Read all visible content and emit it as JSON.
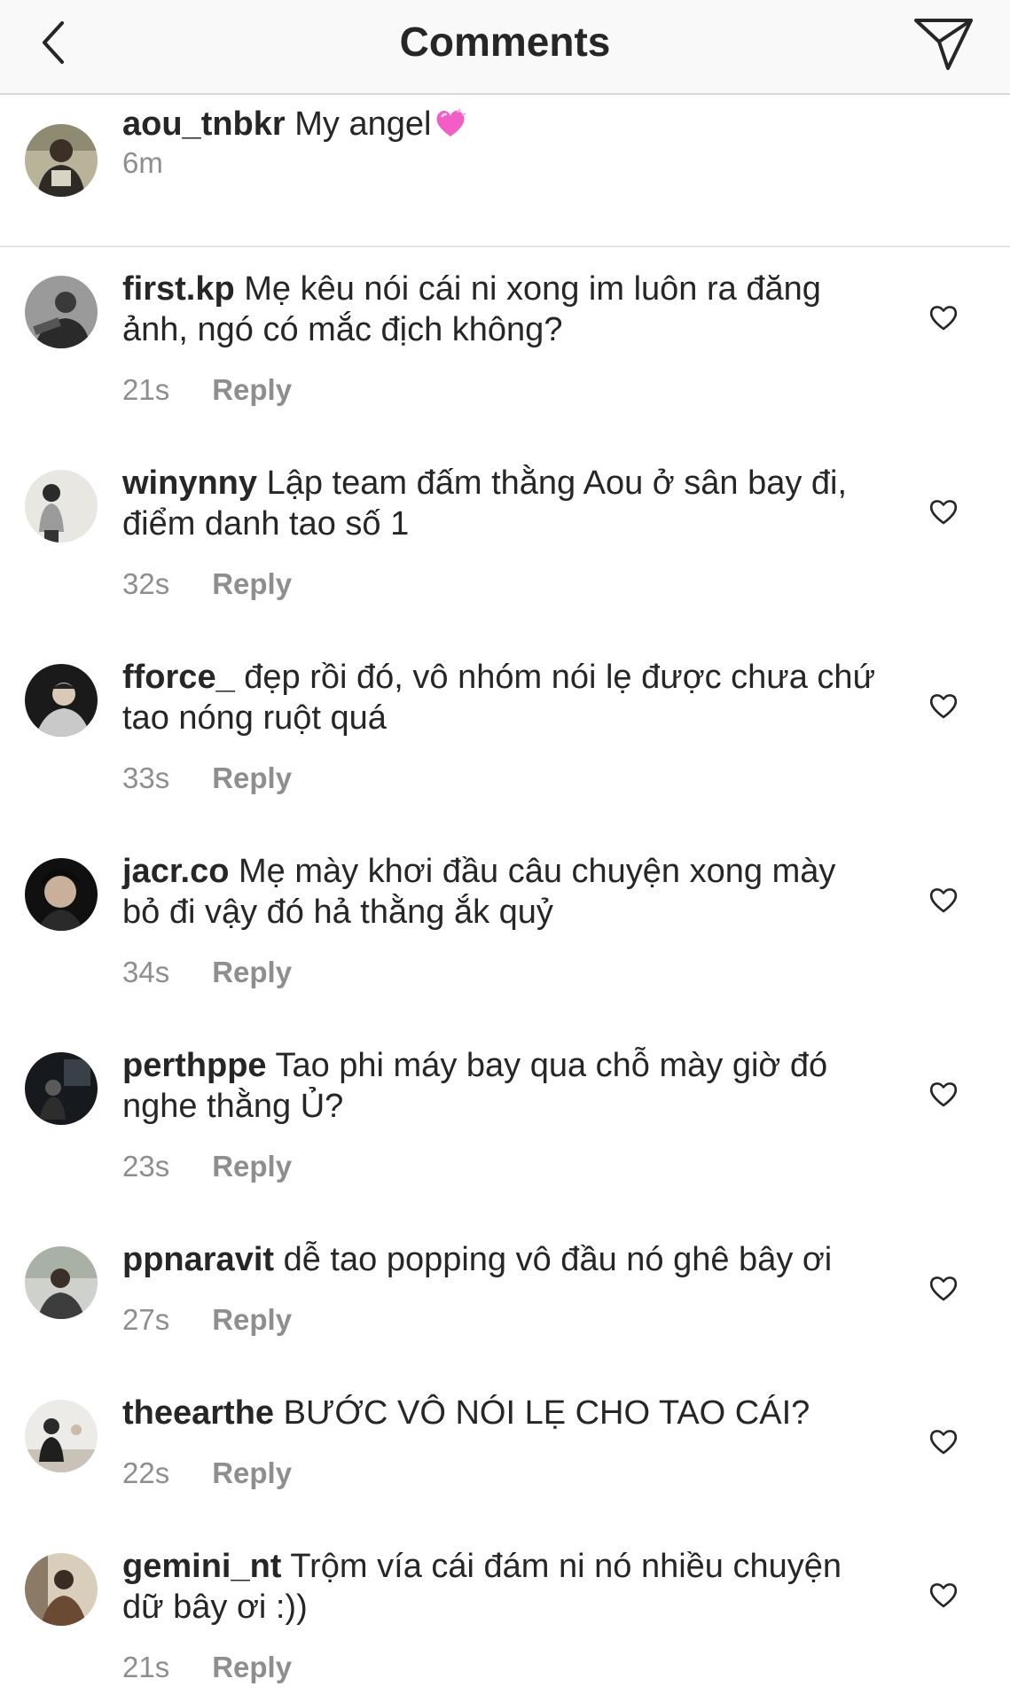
{
  "header": {
    "title": "Comments"
  },
  "caption": {
    "username": "aou_tnbkr",
    "text": "My angel",
    "time": "6m"
  },
  "comments": [
    {
      "username": "first.kp",
      "text": "Mẹ kêu nói cái ni xong im luôn ra đăng ảnh, ngó có mắc địch không?",
      "time": "21s",
      "reply": "Reply"
    },
    {
      "username": "winynny",
      "text": "Lập team đấm thằng Aou ở sân bay đi, điểm danh tao số 1",
      "time": "32s",
      "reply": "Reply"
    },
    {
      "username": "fforce_",
      "text": "đẹp rồi đó, vô nhóm nói lẹ được chưa chứ tao nóng ruột quá",
      "time": "33s",
      "reply": "Reply"
    },
    {
      "username": "jacr.co",
      "text": "Mẹ mày khơi đầu câu chuyện xong mày bỏ đi vậy đó hả thằng ắk quỷ",
      "time": "34s",
      "reply": "Reply"
    },
    {
      "username": "perthppe",
      "text": "Tao phi máy bay qua chỗ mày giờ đó nghe thằng Ủ?",
      "time": "23s",
      "reply": "Reply"
    },
    {
      "username": "ppnaravit",
      "text": "dễ tao popping vô đầu nó ghê bây ơi",
      "time": "27s",
      "reply": "Reply"
    },
    {
      "username": "theearthe",
      "text": "BƯỚC VÔ NÓI LẸ CHO TAO CÁI?",
      "time": "22s",
      "reply": "Reply"
    },
    {
      "username": "gemini_nt",
      "text": "Trộm vía cái đám ni nó nhiều chuyện dữ bây ơi :))",
      "time": "21s",
      "reply": "Reply"
    }
  ]
}
